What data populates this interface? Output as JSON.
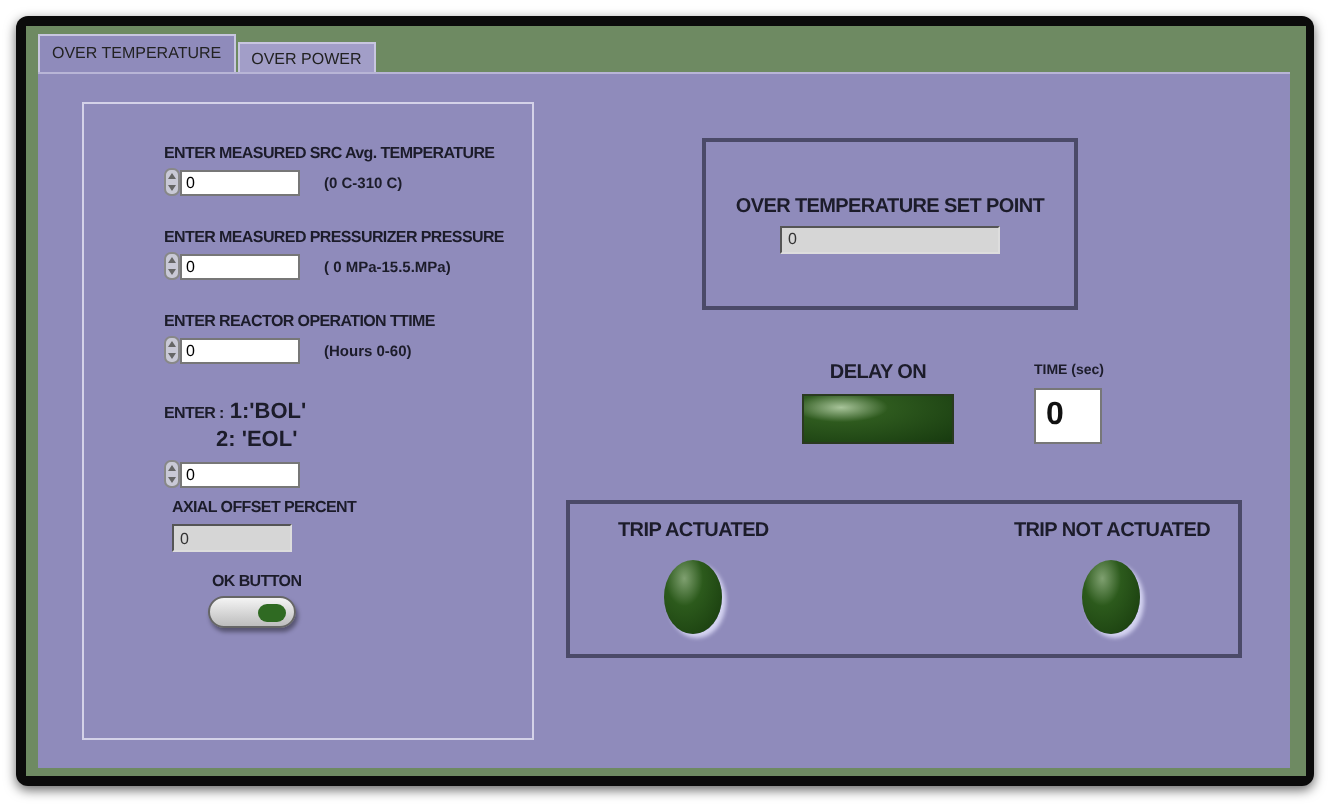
{
  "tabs": [
    {
      "label": "OVER TEMPERATURE",
      "selected": true
    },
    {
      "label": "OVER POWER",
      "selected": false
    }
  ],
  "inputs": {
    "fields": [
      {
        "label": "ENTER MEASURED SRC Avg. TEMPERATURE",
        "value": "0",
        "range": "(0 C-310 C)"
      },
      {
        "label": "ENTER MEASURED PRESSURIZER PRESSURE",
        "value": "0",
        "range": "( 0 MPa-15.5.MPa)"
      },
      {
        "label": "ENTER REACTOR OPERATION TTIME",
        "value": "0",
        "range": "(Hours  0-60)"
      }
    ],
    "mode": {
      "prefix": "ENTER :",
      "line_1": "1:'BOL'",
      "line_2": "2: 'EOL'",
      "value": "0"
    },
    "axial_offset": {
      "label": "AXIAL OFFSET PERCENT",
      "value": "0"
    },
    "ok_button": {
      "label": "OK BUTTON",
      "on": false
    }
  },
  "set_point": {
    "label": "OVER TEMPERATURE SET POINT",
    "value": "0"
  },
  "delay": {
    "label": "DELAY ON",
    "on": false
  },
  "time": {
    "label": "TIME (sec)",
    "value": "0"
  },
  "trips": [
    {
      "label": "TRIP ACTUATED",
      "on": false
    },
    {
      "label": "TRIP NOT ACTUATED",
      "on": false
    }
  ]
}
